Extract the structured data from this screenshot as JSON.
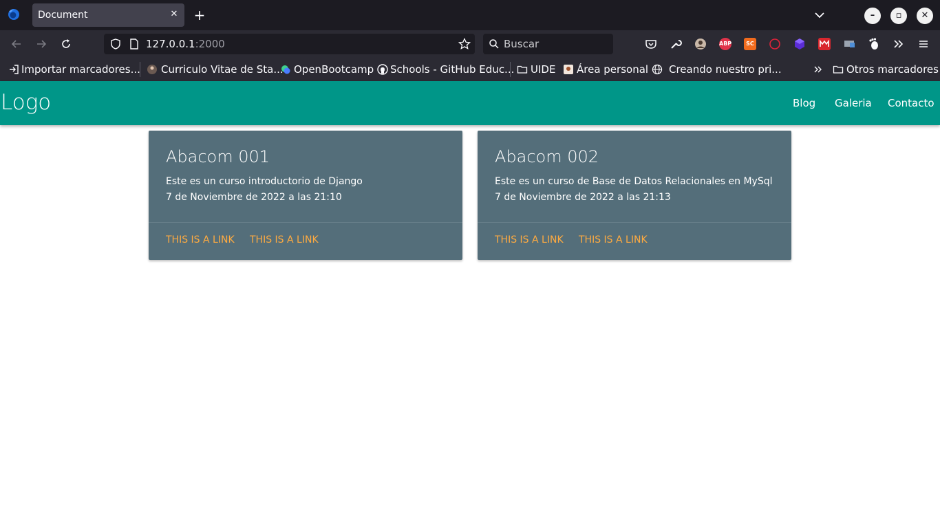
{
  "browser": {
    "tab": {
      "title": "Document",
      "close": "✕"
    },
    "new_tab": "+",
    "url": {
      "host": "127.0.0.1",
      "port": ":2000"
    },
    "search": {
      "placeholder": "Buscar"
    },
    "window_controls": {
      "minimize": "–",
      "maximize": "▫",
      "close": "✕"
    },
    "extensions": [
      "pocket-icon",
      "wrench-icon",
      "avatar-extension-icon",
      "abp-icon",
      "sc-icon",
      "opera-ring-icon",
      "purple-cube-icon",
      "mega-icon",
      "screen-icon",
      "gnome-foot-icon"
    ],
    "ext_labels": {
      "abp": "ABP",
      "sc": "SC"
    },
    "bookmarks": {
      "import": "Importar marcadores...",
      "curriculo": "Curriculo Vitae de Sta...",
      "openbootcamp": "OpenBootcamp",
      "schools": "Schools - GitHub Educ...",
      "uide": "UIDE",
      "area": "Área personal",
      "creando": "Creando nuestro pri...",
      "otros": "Otros marcadores"
    }
  },
  "site": {
    "logo": "Logo",
    "menu": [
      "Blog",
      "Galeria",
      "Contacto"
    ],
    "colors": {
      "navbar": "#009688",
      "card": "#546e7a",
      "link": "#ffab40"
    },
    "cards": [
      {
        "title": "Abacom 001",
        "description": "Este es un curso introductorio de Django",
        "date": "7 de Noviembre de 2022 a las 21:10",
        "links": [
          "THIS IS A LINK",
          "THIS IS A LINK"
        ]
      },
      {
        "title": "Abacom 002",
        "description": "Este es un curso de Base de Datos Relacionales en MySql",
        "date": "7 de Noviembre de 2022 a las 21:13",
        "links": [
          "THIS IS A LINK",
          "THIS IS A LINK"
        ]
      }
    ]
  }
}
